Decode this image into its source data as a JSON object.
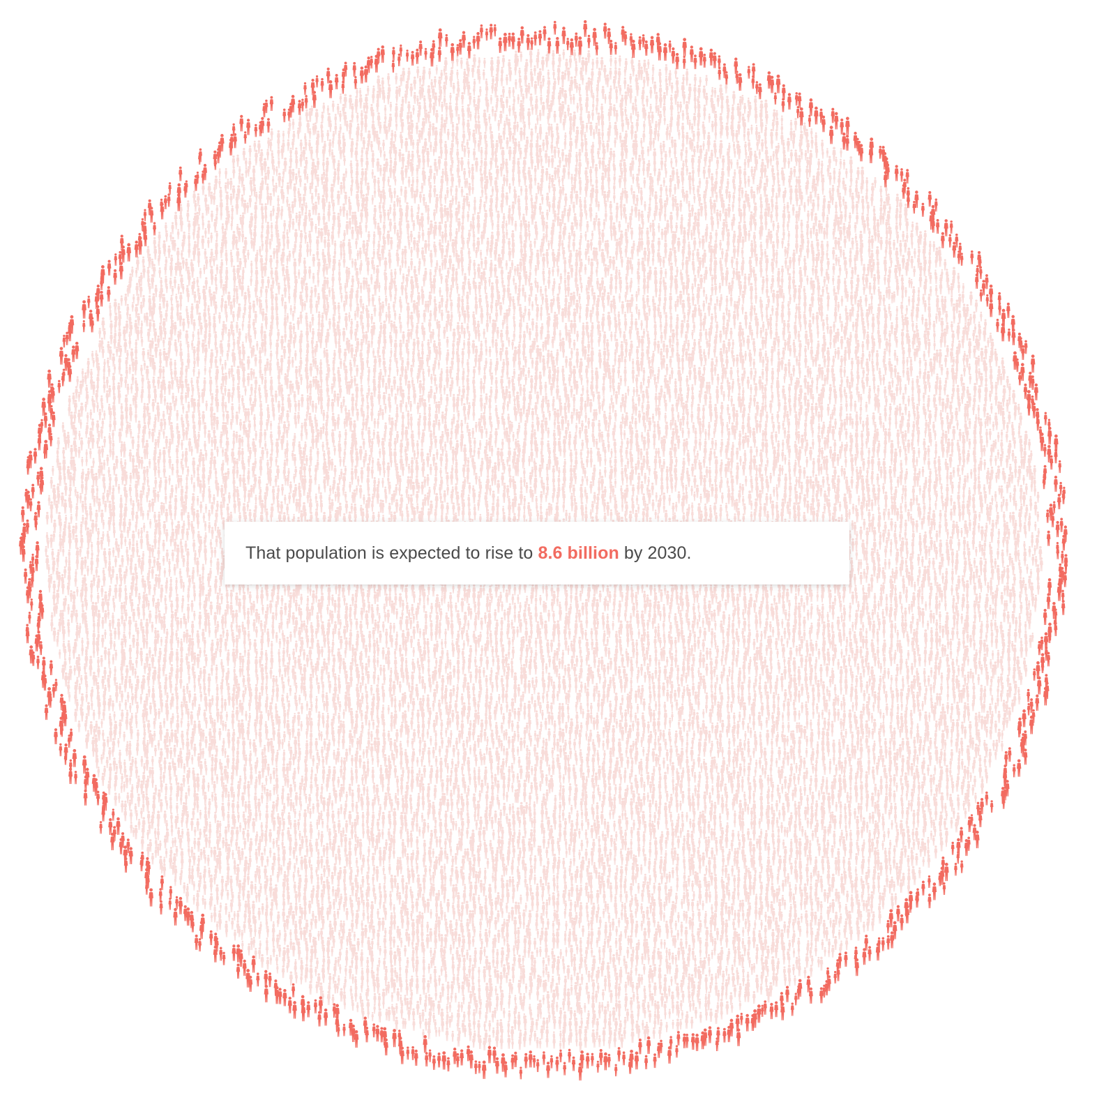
{
  "colors": {
    "ring_figures": "#f26b60",
    "inner_figures": "#f8dcd9",
    "caption_text": "#4a4a4a",
    "highlight": "#f26b60",
    "background": "#ffffff"
  },
  "visual": {
    "type": "population-crowd-circle",
    "icon": "person-figure-icon"
  },
  "caption": {
    "before": "That population is expected to rise to ",
    "highlight": "8.6 billion",
    "after": " by 2030."
  }
}
